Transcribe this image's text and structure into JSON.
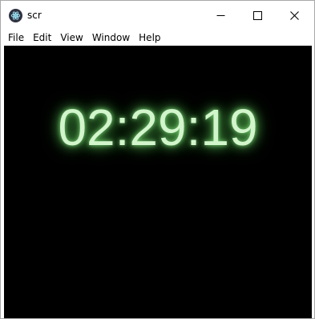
{
  "window": {
    "title": "scr",
    "icon": "app-logo-icon",
    "controls": {
      "minimize_icon": "minimize-icon",
      "maximize_icon": "maximize-icon",
      "close_icon": "close-icon"
    }
  },
  "menu": {
    "items": [
      "File",
      "Edit",
      "View",
      "Window",
      "Help"
    ]
  },
  "clock": {
    "time": "02:29:19",
    "color": "#d2f5cc",
    "glow_color": "#5cc257",
    "background": "#000000"
  }
}
